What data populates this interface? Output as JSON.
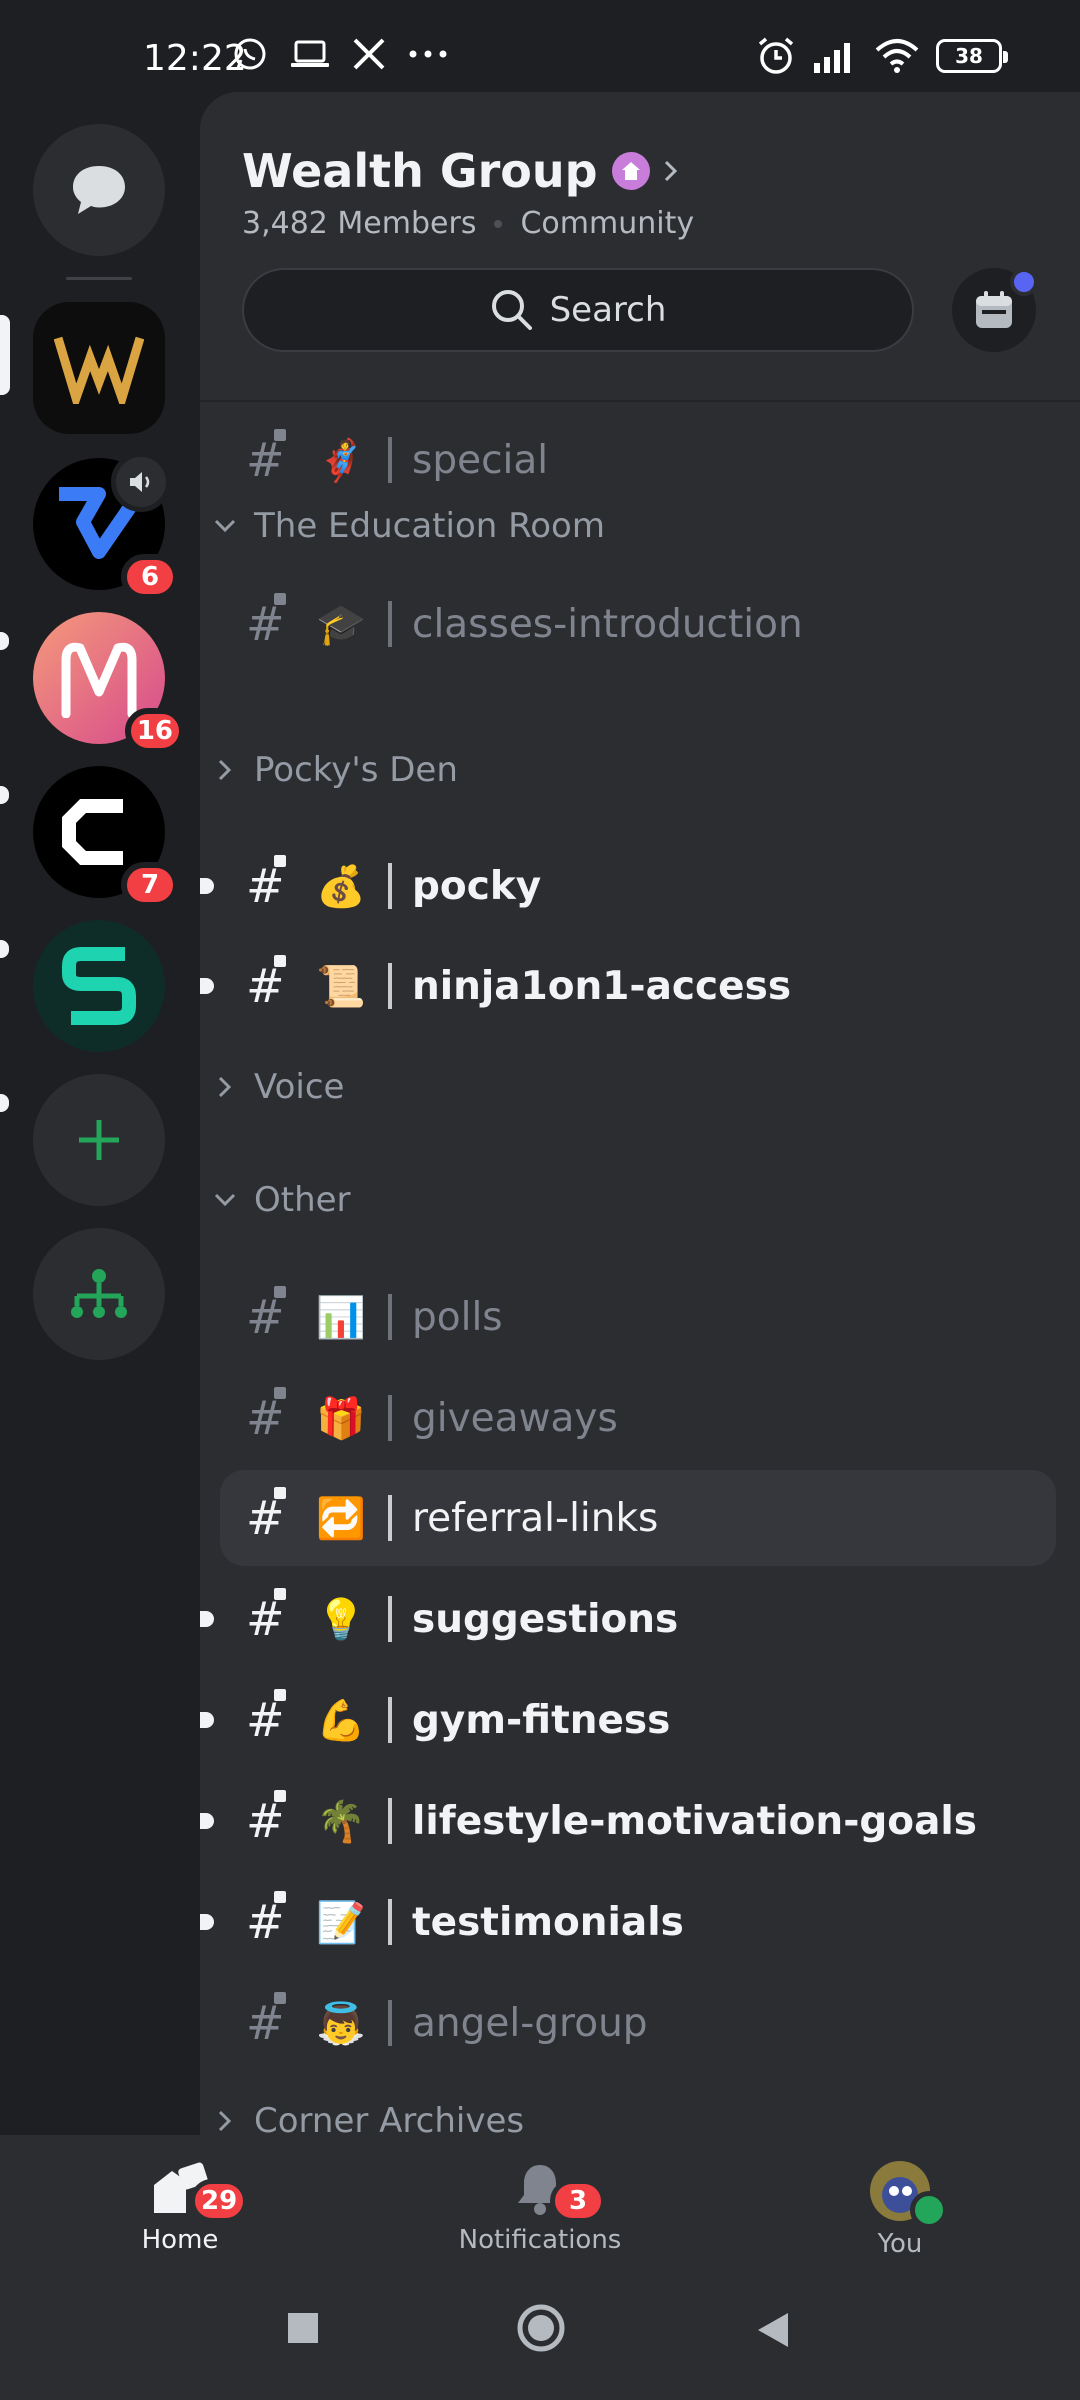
{
  "status_bar": {
    "time": "12:22",
    "battery": "38"
  },
  "servers": [
    {
      "name": "direct-messages",
      "badge": ""
    },
    {
      "name": "wealth-group",
      "badge": ""
    },
    {
      "name": "server-2",
      "badge": "6"
    },
    {
      "name": "server-3",
      "badge": "16"
    },
    {
      "name": "server-4",
      "badge": "7"
    },
    {
      "name": "server-5",
      "badge": ""
    }
  ],
  "header": {
    "server_name": "Wealth Group",
    "members": "3,482 Members",
    "type": "Community",
    "search_label": "Search"
  },
  "channels": {
    "special": {
      "emoji": "🦸",
      "name": "special"
    },
    "education_room": "The Education Room",
    "classes_introduction": {
      "emoji": "🎓",
      "name": "classes-introduction"
    },
    "pockys_den": "Pocky's Den",
    "pocky": {
      "emoji": "💰",
      "name": "pocky"
    },
    "ninja": {
      "emoji": "📜",
      "name": "ninja1on1-access"
    },
    "voice": "Voice",
    "other": "Other",
    "polls": {
      "emoji": "📊",
      "name": "polls"
    },
    "giveaways": {
      "emoji": "🎁",
      "name": "giveaways"
    },
    "referral": {
      "emoji": "🔁",
      "name": "referral-links"
    },
    "suggestions": {
      "emoji": "💡",
      "name": "suggestions"
    },
    "gym": {
      "emoji": "💪",
      "name": "gym-fitness"
    },
    "lifestyle": {
      "emoji": "🌴",
      "name": "lifestyle-motivation-goals"
    },
    "testimonials": {
      "emoji": "📝",
      "name": "testimonials"
    },
    "angel": {
      "emoji": "👼",
      "name": "angel-group"
    },
    "corner_archives": "Corner Archives"
  },
  "bottom_nav": {
    "home": {
      "label": "Home",
      "badge": "29"
    },
    "notifications": {
      "label": "Notifications",
      "badge": "3"
    },
    "you": {
      "label": "You"
    }
  },
  "colors": {
    "background": "#1e1f22",
    "panel": "#2b2d31",
    "badge": "#f23f43",
    "accent": "#5865f2",
    "add_server_green": "#23a55a"
  }
}
